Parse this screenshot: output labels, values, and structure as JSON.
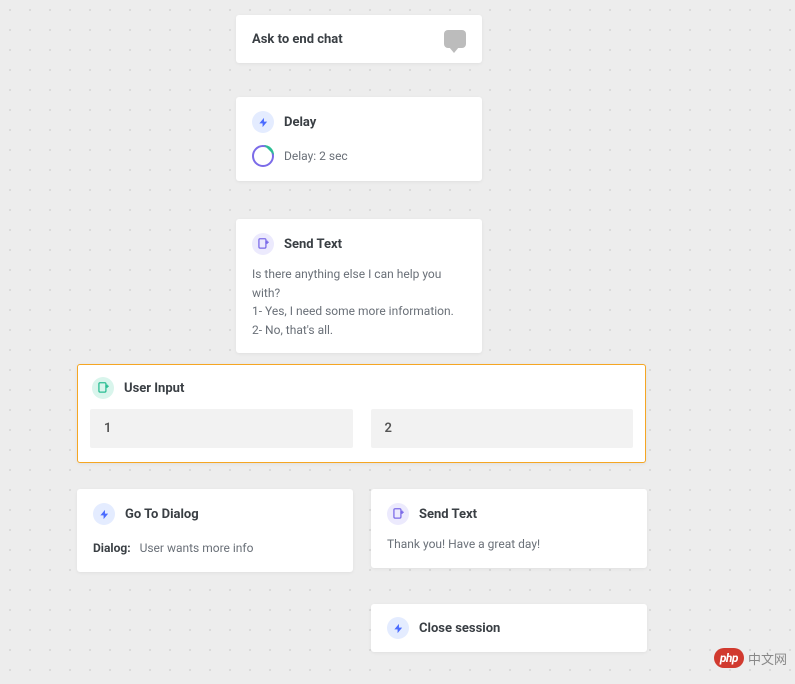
{
  "nodes": {
    "ask": {
      "title": "Ask to end chat"
    },
    "delay": {
      "title": "Delay",
      "detail": "Delay: 2 sec"
    },
    "sendText1": {
      "title": "Send Text",
      "line1": "Is there anything else I can help you with?",
      "line2": "1- Yes, I need some more information.",
      "line3": "2- No, that's all."
    },
    "userInput": {
      "title": "User Input",
      "opt1": "1",
      "opt2": "2"
    },
    "goToDialog": {
      "title": "Go To Dialog",
      "label": "Dialog:",
      "value": "User wants more info"
    },
    "sendText2": {
      "title": "Send Text",
      "body": "Thank you! Have a great day!"
    },
    "closeSession": {
      "title": "Close session"
    }
  },
  "watermark": {
    "badge": "php",
    "text": "中文网"
  }
}
